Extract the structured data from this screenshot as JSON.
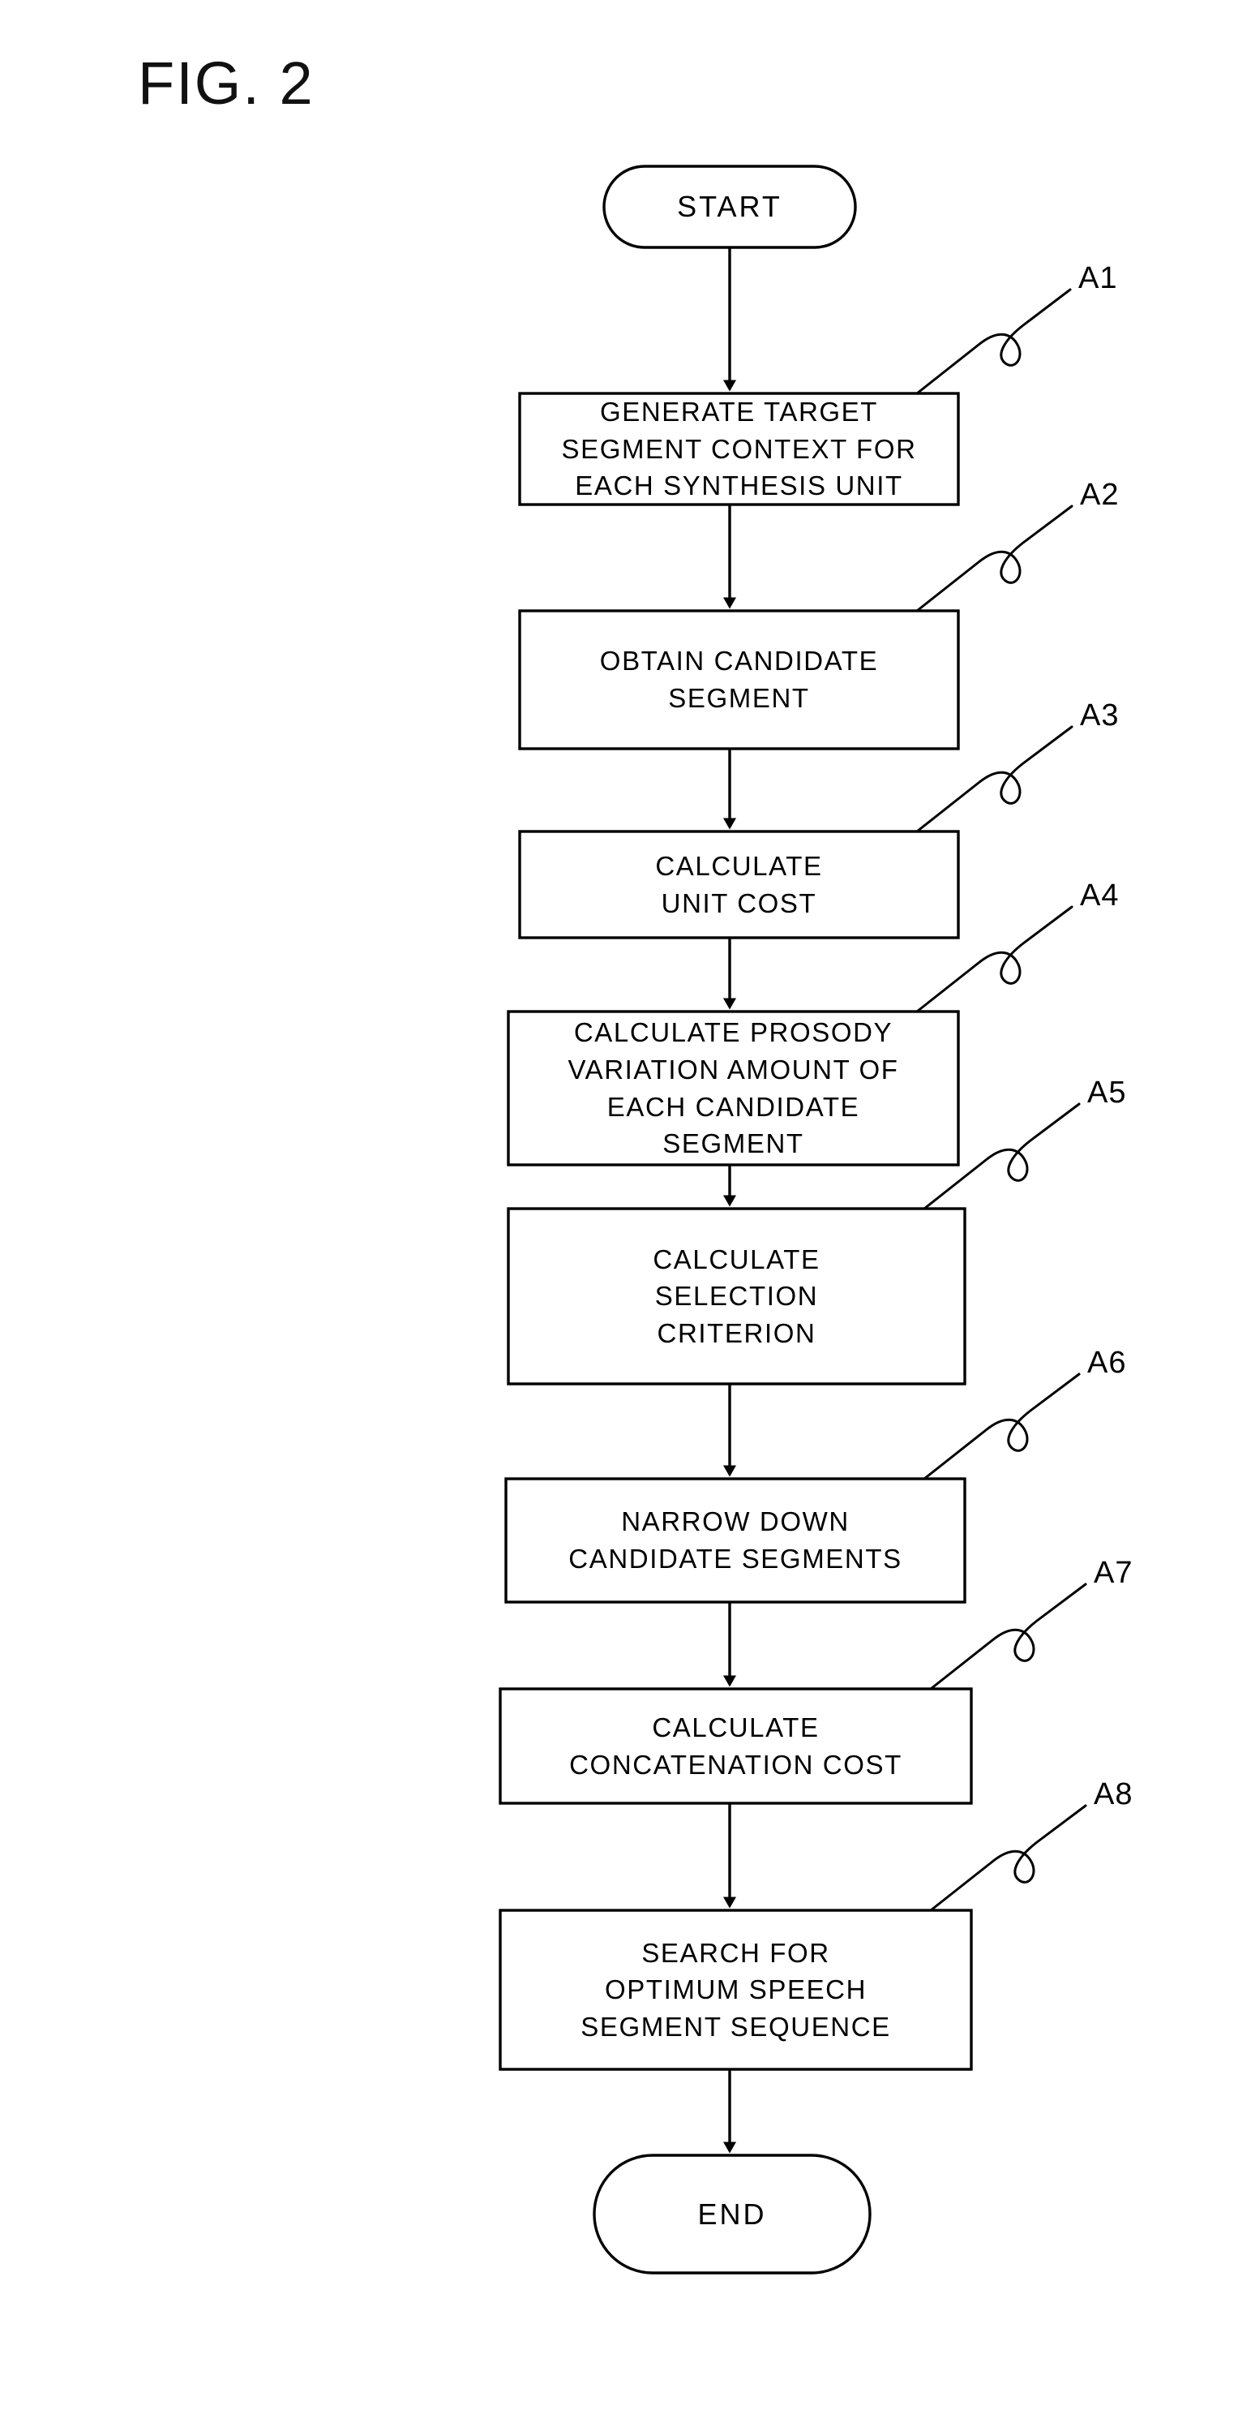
{
  "figure": {
    "title": "FIG. 2",
    "type": "flowchart",
    "orientation": "vertical"
  },
  "nodes": [
    {
      "id": "start",
      "shape": "terminal",
      "lines": [
        "START"
      ],
      "ref": null
    },
    {
      "id": "a1",
      "shape": "process",
      "lines": [
        "GENERATE TARGET",
        "SEGMENT CONTEXT FOR",
        "EACH SYNTHESIS UNIT"
      ],
      "ref": "A1"
    },
    {
      "id": "a2",
      "shape": "process",
      "lines": [
        "OBTAIN CANDIDATE",
        "SEGMENT"
      ],
      "ref": "A2"
    },
    {
      "id": "a3",
      "shape": "process",
      "lines": [
        "CALCULATE",
        "UNIT COST"
      ],
      "ref": "A3"
    },
    {
      "id": "a4",
      "shape": "process",
      "lines": [
        "CALCULATE PROSODY",
        "VARIATION AMOUNT OF",
        "EACH CANDIDATE",
        "SEGMENT"
      ],
      "ref": "A4"
    },
    {
      "id": "a5",
      "shape": "process",
      "lines": [
        "CALCULATE",
        "SELECTION",
        "CRITERION"
      ],
      "ref": "A5"
    },
    {
      "id": "a6",
      "shape": "process",
      "lines": [
        "NARROW DOWN",
        "CANDIDATE SEGMENTS"
      ],
      "ref": "A6"
    },
    {
      "id": "a7",
      "shape": "process",
      "lines": [
        "CALCULATE",
        "CONCATENATION COST"
      ],
      "ref": "A7"
    },
    {
      "id": "a8",
      "shape": "process",
      "lines": [
        "SEARCH FOR",
        "OPTIMUM SPEECH",
        "SEGMENT SEQUENCE"
      ],
      "ref": "A8"
    },
    {
      "id": "end",
      "shape": "terminal",
      "lines": [
        "END"
      ],
      "ref": null
    }
  ],
  "refs": {
    "a1": "A1",
    "a2": "A2",
    "a3": "A3",
    "a4": "A4",
    "a5": "A5",
    "a6": "A6",
    "a7": "A7",
    "a8": "A8"
  },
  "node_lines": {
    "start": {
      "l0": "START"
    },
    "a1": {
      "l0": "GENERATE TARGET",
      "l1": "SEGMENT CONTEXT FOR",
      "l2": "EACH SYNTHESIS UNIT"
    },
    "a2": {
      "l0": "OBTAIN CANDIDATE",
      "l1": "SEGMENT"
    },
    "a3": {
      "l0": "CALCULATE",
      "l1": "UNIT COST"
    },
    "a4": {
      "l0": "CALCULATE PROSODY",
      "l1": "VARIATION AMOUNT OF",
      "l2": "EACH CANDIDATE",
      "l3": "SEGMENT"
    },
    "a5": {
      "l0": "CALCULATE",
      "l1": "SELECTION",
      "l2": "CRITERION"
    },
    "a6": {
      "l0": "NARROW DOWN",
      "l1": "CANDIDATE SEGMENTS"
    },
    "a7": {
      "l0": "CALCULATE",
      "l1": "CONCATENATION COST"
    },
    "a8": {
      "l0": "SEARCH FOR",
      "l1": "OPTIMUM SPEECH",
      "l2": "SEGMENT SEQUENCE"
    },
    "end": {
      "l0": "END"
    }
  },
  "colors": {
    "ink": "#000000",
    "paper": "#ffffff"
  }
}
